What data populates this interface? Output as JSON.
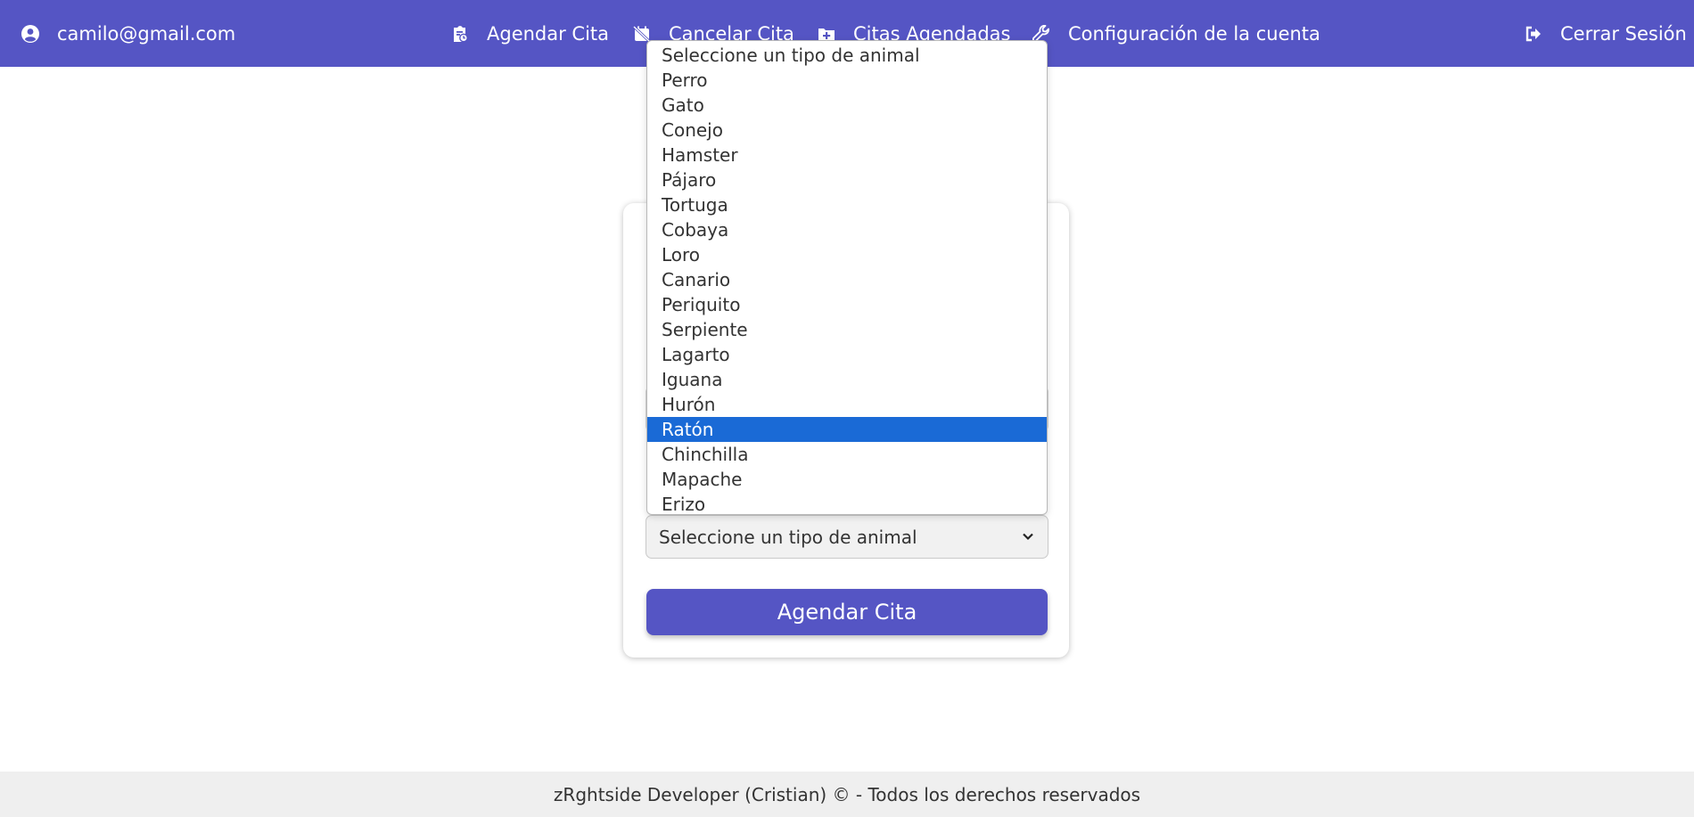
{
  "navbar": {
    "user_email": "camilo@gmail.com",
    "user_icon": "user-circle-icon",
    "items": [
      {
        "label": "Agendar Cita",
        "icon": "clipboard-calendar-icon"
      },
      {
        "label": "Cancelar Cita",
        "icon": "calendar-cancel-icon"
      },
      {
        "label": "Citas Agendadas",
        "icon": "folder-plus-icon"
      },
      {
        "label": "Configuración de la cuenta",
        "icon": "wrench-icon"
      }
    ],
    "logout": {
      "label": "Cerrar Sesión",
      "icon": "sign-out-icon"
    },
    "background_color": "#5555c4"
  },
  "form": {
    "animal_select": {
      "value": "Seleccione un tipo de animal",
      "options": [
        "Seleccione un tipo de animal",
        "Perro",
        "Gato",
        "Conejo",
        "Hamster",
        "Pájaro",
        "Tortuga",
        "Cobaya",
        "Loro",
        "Canario",
        "Periquito",
        "Serpiente",
        "Lagarto",
        "Iguana",
        "Hurón",
        "Ratón",
        "Chinchilla",
        "Mapache",
        "Erizo"
      ],
      "highlighted": "Ratón",
      "highlight_color": "#1a6ad6"
    },
    "submit_label": "Agendar Cita"
  },
  "footer": {
    "text": "zRghtside Developer (Cristian) © - Todos los derechos reservados"
  }
}
